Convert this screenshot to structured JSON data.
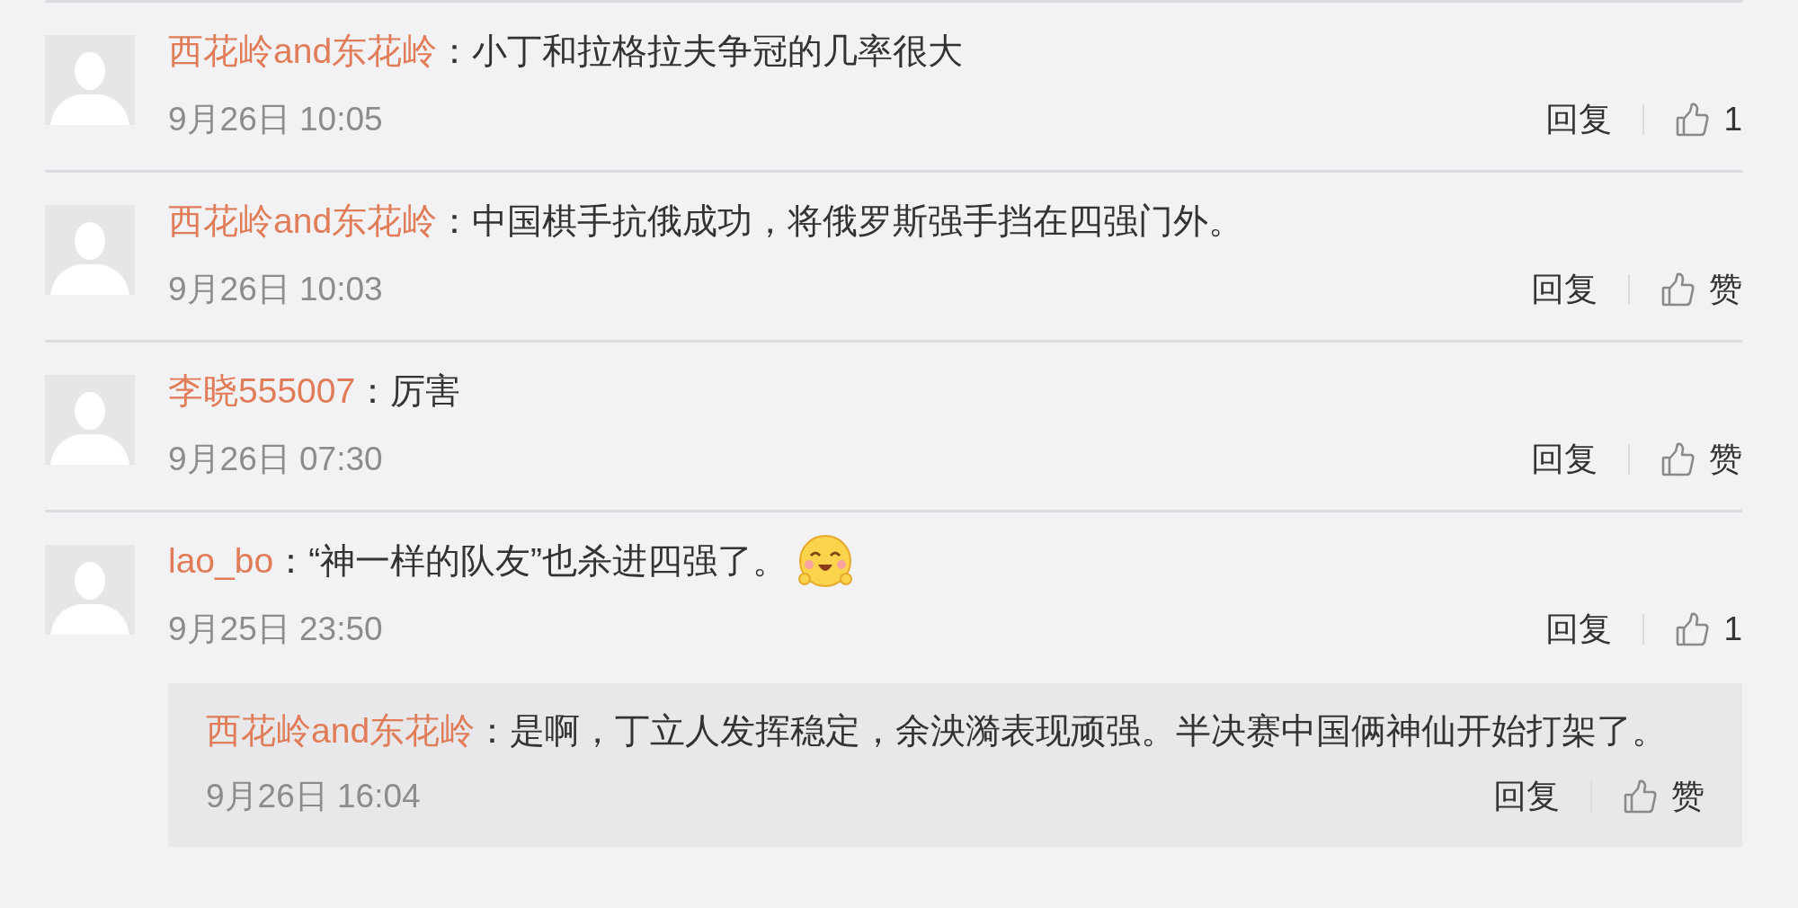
{
  "comments": [
    {
      "user": "西花岭and东花岭",
      "colon": "：",
      "text": "小丁和拉格拉夫争冠的几率很大",
      "time": "9月26日 10:05",
      "reply": "回复",
      "like": "1"
    },
    {
      "user": "西花岭and东花岭",
      "colon": "：",
      "text": "中国棋手抗俄成功，将俄罗斯强手挡在四强门外。",
      "time": "9月26日 10:03",
      "reply": "回复",
      "like": "赞"
    },
    {
      "user": "李晓555007",
      "colon": "：",
      "text": "厉害",
      "time": "9月26日 07:30",
      "reply": "回复",
      "like": "赞"
    },
    {
      "user": "lao_bo",
      "colon": "：",
      "text": "“神一样的队友”也杀进四强了。",
      "emoji": true,
      "time": "9月25日 23:50",
      "reply": "回复",
      "like": "1",
      "replies": [
        {
          "user": "西花岭and东花岭",
          "colon": "：",
          "text": "是啊，丁立人发挥稳定，余泱漪表现顽强。半决赛中国俩神仙开始打架了。",
          "time": "9月26日 16:04",
          "reply": "回复",
          "like": "赞"
        }
      ]
    }
  ]
}
